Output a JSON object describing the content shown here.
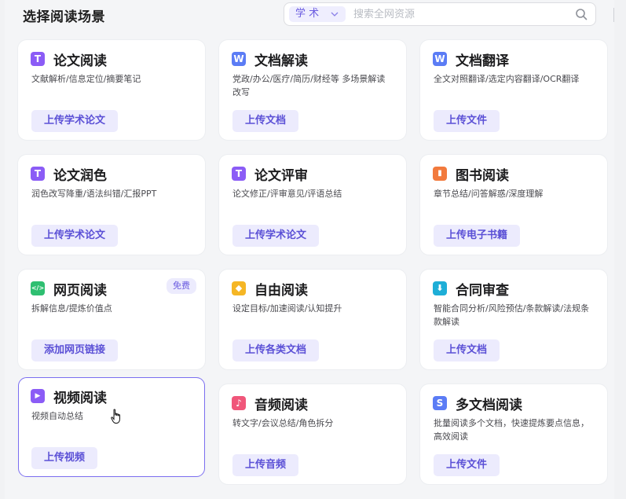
{
  "header": {
    "title": "选择阅读场景"
  },
  "search": {
    "scope": "学 术",
    "placeholder": "搜索全网资源"
  },
  "cards": [
    {
      "icon_text": "T",
      "icon_color": "#8b5cf6",
      "icon_name": "paper-icon",
      "title": "论文阅读",
      "desc": "文献解析/信息定位/摘要笔记",
      "button": "上传学术论文"
    },
    {
      "icon_text": "W",
      "icon_color": "#5b7cf5",
      "icon_name": "word-icon",
      "title": "文档解读",
      "desc": "党政/办公/医疗/简历/财经等 多场景解读改写",
      "button": "上传文档"
    },
    {
      "icon_text": "W",
      "icon_color": "#5b7cf5",
      "icon_name": "word-icon",
      "title": "文档翻译",
      "desc": "全文对照翻译/选定内容翻译/OCR翻译",
      "button": "上传文件"
    },
    {
      "icon_text": "T",
      "icon_color": "#8b5cf6",
      "icon_name": "paper-icon",
      "title": "论文润色",
      "desc": "润色改写降重/语法纠错/汇报PPT",
      "button": "上传学术论文"
    },
    {
      "icon_text": "T",
      "icon_color": "#8b5cf6",
      "icon_name": "paper-icon",
      "title": "论文评审",
      "desc": "论文修正/评审意见/评语总结",
      "button": "上传学术论文"
    },
    {
      "icon_text": "▮",
      "icon_color": "#f27a3d",
      "icon_name": "bookmark-icon",
      "title": "图书阅读",
      "desc": "章节总结/问答解惑/深度理解",
      "button": "上传电子书籍"
    },
    {
      "icon_text": "</>",
      "icon_color": "#2fbf71",
      "icon_name": "code-icon",
      "title": "网页阅读",
      "desc": "拆解信息/提炼价值点",
      "button": "添加网页链接",
      "badge": "免费"
    },
    {
      "icon_text": "◆",
      "icon_color": "#f5b625",
      "icon_name": "diamond-icon",
      "title": "自由阅读",
      "desc": "设定目标/加速阅读/认知提升",
      "button": "上传各类文档"
    },
    {
      "icon_text": "⬇",
      "icon_color": "#1eaed7",
      "icon_name": "download-icon",
      "title": "合同审查",
      "desc": "智能合同分析/风险预估/条款解读/法规条款解读",
      "button": "上传文档"
    },
    {
      "icon_text": "▶",
      "icon_color": "#8b5cf6",
      "icon_name": "play-icon",
      "title": "视频阅读",
      "desc": "视频自动总结",
      "button": "上传视频"
    },
    {
      "icon_text": "♪",
      "icon_color": "#f0567a",
      "icon_name": "music-icon",
      "title": "音频阅读",
      "desc": "转文字/会议总结/角色拆分",
      "button": "上传音频"
    },
    {
      "icon_text": "S",
      "icon_color": "#5b7cf5",
      "icon_name": "multi-doc-icon",
      "title": "多文档阅读",
      "desc": "批量阅读多个文档，快速提炼要点信息，高效阅读",
      "button": "上传文件"
    }
  ]
}
